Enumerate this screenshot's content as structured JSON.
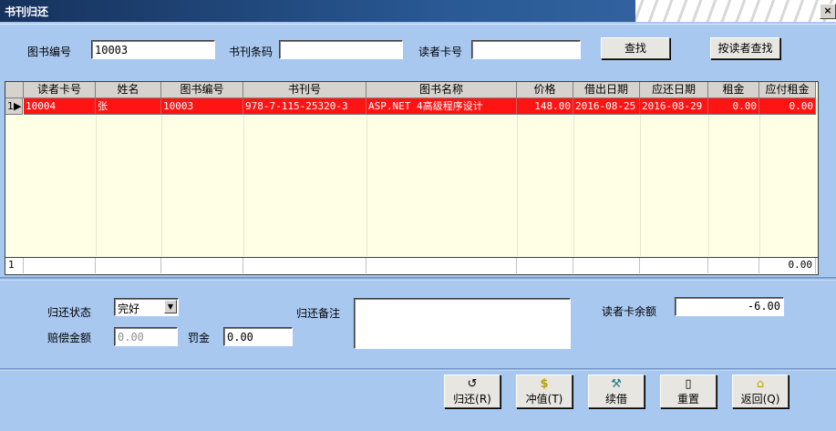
{
  "window": {
    "title": "书刊归还",
    "close": "×"
  },
  "search": {
    "book_no_label": "图书编号",
    "book_no_value": "10003",
    "barcode_label": "书刊条码",
    "barcode_value": "",
    "card_label": "读者卡号",
    "card_value": "",
    "find_button": "查找",
    "find_by_reader_button": "按读者查找"
  },
  "grid": {
    "columns": [
      "读者卡号",
      "姓名",
      "图书编号",
      "书刊号",
      "图书名称",
      "价格",
      "借出日期",
      "应还日期",
      "租金",
      "应付租金"
    ],
    "rows": [
      {
        "indicator": "1",
        "cells": [
          "10004",
          "张",
          "10003",
          "978-7-115-25320-3",
          "ASP.NET 4高级程序设计",
          "148.00",
          "2016-08-25",
          "2016-08-29",
          "0.00",
          "0.00"
        ]
      }
    ],
    "footer": {
      "indicator": "1",
      "total": "0.00"
    }
  },
  "return_form": {
    "status_label": "归还状态",
    "status_value": "完好",
    "compensation_label": "赔偿金额",
    "compensation_value": "0.00",
    "fine_label": "罚金",
    "fine_value": "0.00",
    "remark_label": "归还备注",
    "remark_value": "",
    "balance_label": "读者卡余额",
    "balance_value": "-6.00"
  },
  "actions": [
    {
      "name": "return-button",
      "label": "归还(R)",
      "icon": "↺"
    },
    {
      "name": "recharge-button",
      "label": "冲值(T)",
      "icon": "$"
    },
    {
      "name": "renew-button",
      "label": "续借",
      "icon": "⚒"
    },
    {
      "name": "reset-button",
      "label": "重置",
      "icon": "▯"
    },
    {
      "name": "back-button",
      "label": "返回(Q)",
      "icon": "⌂"
    }
  ],
  "colors": {
    "selected_row": "#ff1414",
    "panel": "#a8c8f0",
    "grid_bg": "#ffffe6",
    "title_bar": "#16325c"
  }
}
